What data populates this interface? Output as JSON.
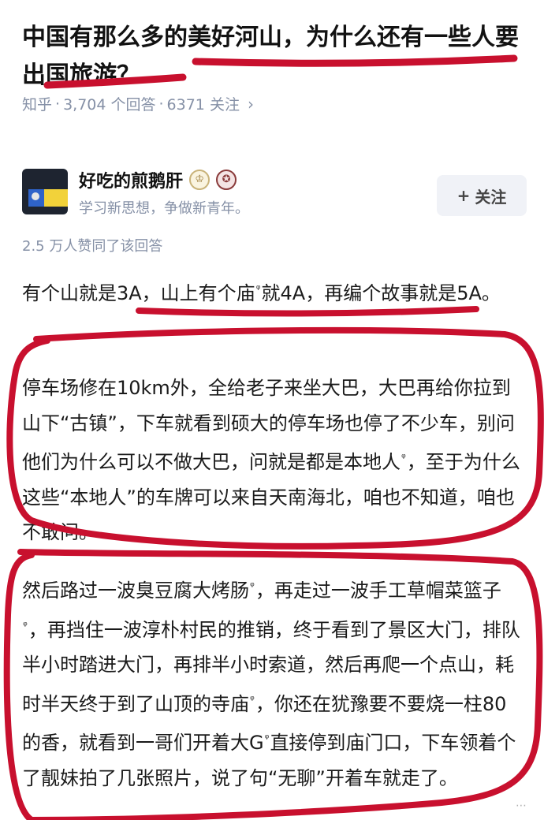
{
  "question": {
    "title": "中国有那么多的美好河山，为什么还有一些人要出国旅游？",
    "meta_site": "知乎",
    "meta_sep": "·",
    "answers": "3,704 个回答",
    "followers": "6371 关注",
    "chevron_icon": "chevron-right-icon"
  },
  "author": {
    "name": "好吃的煎鹅肝",
    "bio": "学习新思想，争做新青年。",
    "badge1_icon": "crown-badge-icon",
    "badge2_icon": "medal-badge-icon",
    "follow_label": "关注",
    "follow_prefix": "+"
  },
  "answer": {
    "likes": "2.5 万人赞同了该回答",
    "p1": [
      "有个山就是3A，山上有个庙",
      "就4A，再编个故事就是5A。"
    ],
    "p2": [
      "停车场修在10km外，全给老子来坐大巴，大巴再给你拉到山下“古镇”，下车就看到硕大的停车场也停了不少车，别问他们为什么可以不做大巴，问就是都是本地人",
      "，至于为什么这些“本地人”的车牌可以来自天南海北，咱也不知道，咱也不敢问。"
    ],
    "p3": [
      "然后路过一波臭豆腐大烤肠",
      "，再走过一波手工草帽菜篮子",
      "，再挡住一波淳朴村民的推销，终于看到了景区大门，排队半小时踏进大门，再排半小时索道，然后再爬一个点山，耗时半天终于到了山顶的寺庙",
      "，你还在犹豫要不要烧一柱80的香，就看到一哥们开着大G",
      "直接停到庙门口，下车领着个了靓妹拍了几张照片，说了句“无聊”开着车就走了。"
    ],
    "search_glyph": "ᵠ"
  },
  "annotation_color": "#c8102e",
  "muted_color": "#8590a6"
}
